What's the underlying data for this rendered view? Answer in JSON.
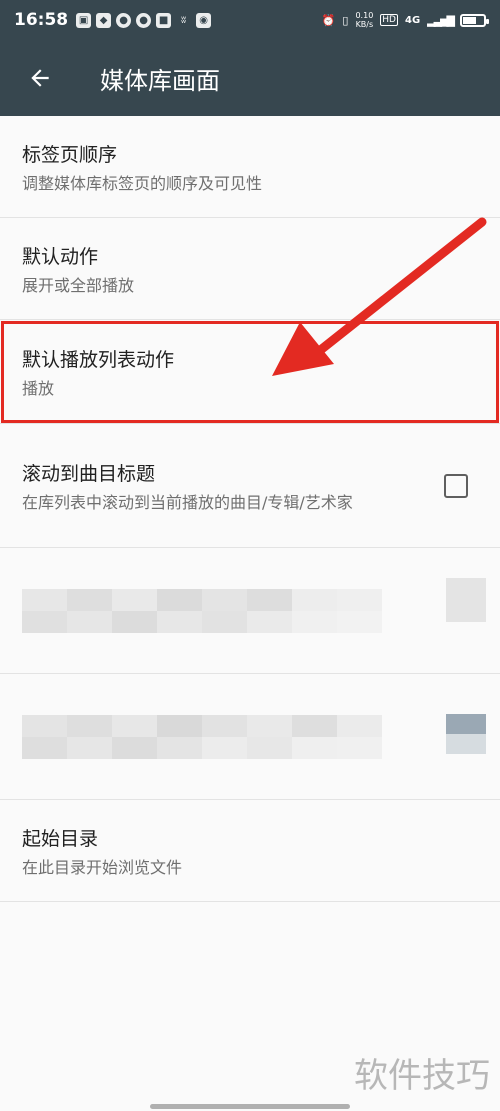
{
  "status_bar": {
    "time": "16:58",
    "net_speed_value": "0.10",
    "net_speed_unit": "KB/s",
    "signal_label": "4G",
    "hd_label": "HD",
    "battery_level": 0.65
  },
  "app_bar": {
    "title": "媒体库画面"
  },
  "settings": [
    {
      "title": "标签页顺序",
      "subtitle": "调整媒体库标签页的顺序及可见性"
    },
    {
      "title": "默认动作",
      "subtitle": "展开或全部播放"
    },
    {
      "title": "默认播放列表动作",
      "subtitle": "播放"
    },
    {
      "title": "滚动到曲目标题",
      "subtitle": "在库列表中滚动到当前播放的曲目/专辑/艺术家",
      "checked": false
    },
    {
      "title": "起始目录",
      "subtitle": "在此目录开始浏览文件"
    }
  ],
  "watermark": "软件技巧",
  "colors": {
    "app_bar_bg": "#37474f",
    "highlight": "#e32a22",
    "background": "#fafafa"
  }
}
